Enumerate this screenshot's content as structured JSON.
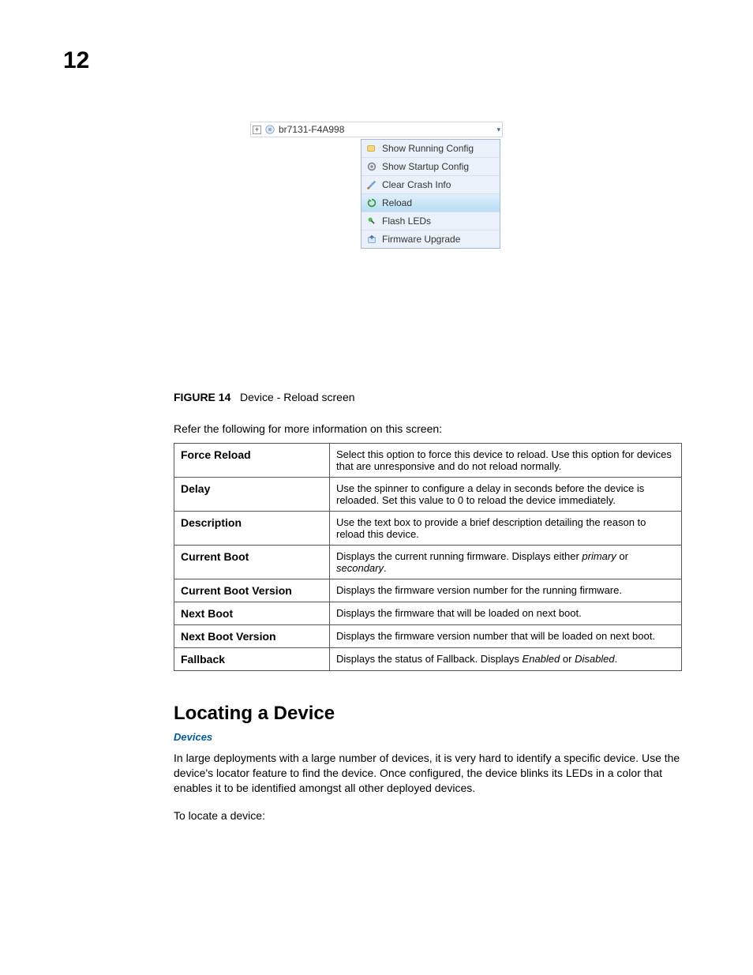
{
  "pageNumber": "12",
  "ui": {
    "treeItemLabel": "br7131-F4A998",
    "menuItems": [
      {
        "label": "Show Running Config",
        "selected": false
      },
      {
        "label": "Show Startup Config",
        "selected": false
      },
      {
        "label": "Clear Crash Info",
        "selected": false
      },
      {
        "label": "Reload",
        "selected": true
      },
      {
        "label": "Flash LEDs",
        "selected": false
      },
      {
        "label": "Firmware Upgrade",
        "selected": false
      }
    ]
  },
  "figure": {
    "label": "FIGURE 14",
    "caption": "Device - Reload screen"
  },
  "introText": "Refer the following for more information on this screen:",
  "rows": [
    {
      "label": "Force Reload",
      "desc": "Select this option to force this device to reload. Use this option for devices that are unresponsive and do not reload normally."
    },
    {
      "label": "Delay",
      "desc": "Use the spinner to configure a delay in seconds before the device is reloaded. Set this value to 0 to reload the device immediately."
    },
    {
      "label": "Description",
      "desc": "Use the text box to provide a brief description detailing the reason to reload this device."
    },
    {
      "label": "Current Boot",
      "desc": "Displays the current running firmware. Displays either <i>primary</i> or <i>secondary</i>."
    },
    {
      "label": "Current Boot Version",
      "desc": "Displays the firmware version number for the running firmware."
    },
    {
      "label": "Next Boot",
      "desc": "Displays the firmware that will be loaded on next boot."
    },
    {
      "label": "Next Boot Version",
      "desc": "Displays the firmware version number that will be loaded on next boot."
    },
    {
      "label": "Fallback",
      "desc": "Displays the status of Fallback. Displays <i>Enabled</i> or <i>Disabled</i>."
    }
  ],
  "section": {
    "heading": "Locating a Device",
    "breadcrumb": "Devices",
    "para": "In large deployments with a large number of devices, it is very hard to identify a specific device. Use the device's locator feature to find the device. Once configured, the device blinks its LEDs in a color that enables it to be identified amongst all other deployed devices.",
    "lead": "To locate a device:"
  }
}
